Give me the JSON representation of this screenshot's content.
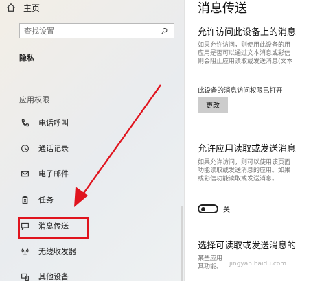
{
  "sidebar": {
    "home_label": "主页",
    "search_placeholder": "查找设置",
    "privacy_heading": "隐私",
    "section_title": "应用权限",
    "items": [
      {
        "label": "电话呼叫"
      },
      {
        "label": "通话记录"
      },
      {
        "label": "电子邮件"
      },
      {
        "label": "任务"
      },
      {
        "label": "消息传送"
      },
      {
        "label": "无线收发器"
      },
      {
        "label": "其他设备"
      }
    ]
  },
  "main": {
    "title": "消息传送",
    "section1": {
      "heading": "允许访问此设备上的消息",
      "desc": [
        "如果允许访问，则使用此设备的用",
        "应用是否可以通过文本消息或彩信",
        "则会阻止应用读取或发送消息(文本"
      ],
      "status": "此设备的消息访问权限已打开",
      "button": "更改"
    },
    "section2": {
      "heading": "允许应用读取或发送消息",
      "desc": [
        "如果允许访问，则可以使用该页面",
        "功能读取或发送消息的应用。如果",
        "或彩信功能读取或发送消息。"
      ],
      "toggle_label": "关"
    },
    "section3": {
      "heading": "选择可读取或发送消息的",
      "desc": [
        "某些应用",
        "其功能。"
      ]
    }
  },
  "annotation": {
    "arrow_color": "#e0141e",
    "highlight_color": "#e0141e"
  },
  "watermark": "jingyan.baidu.com"
}
